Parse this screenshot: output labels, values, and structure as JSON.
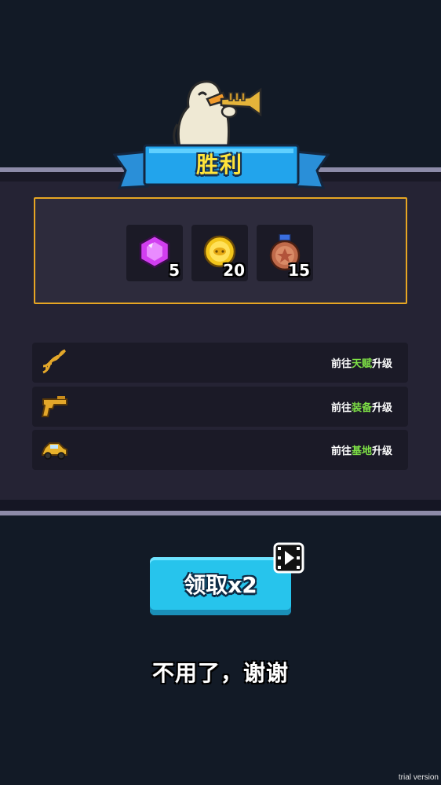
{
  "header": {
    "title": "胜利",
    "mascot_icon": "duck-trumpet-icon"
  },
  "rewards": [
    {
      "icon": "gem-icon",
      "count": "5",
      "color": "#d13ef0"
    },
    {
      "icon": "coin-icon",
      "count": "20",
      "color": "#f3c51b"
    },
    {
      "icon": "medal-icon",
      "count": "15",
      "color": "#c06a4a"
    }
  ],
  "upgrades": [
    {
      "icon": "dna-icon",
      "prefix": "前往",
      "highlight": "天赋",
      "suffix": "升级"
    },
    {
      "icon": "pistol-icon",
      "prefix": "前往",
      "highlight": "装备",
      "suffix": "升级"
    },
    {
      "icon": "car-icon",
      "prefix": "前往",
      "highlight": "基地",
      "suffix": "升级"
    }
  ],
  "actions": {
    "claim_label": "领取x2",
    "claim_icon": "video-ad-icon",
    "decline_label": "不用了，谢谢"
  },
  "watermark": "trial version",
  "colors": {
    "accent_blue": "#27c4ec",
    "title_yellow": "#ffe43a",
    "box_border": "#e7a623",
    "highlight_green": "#7ee046"
  }
}
